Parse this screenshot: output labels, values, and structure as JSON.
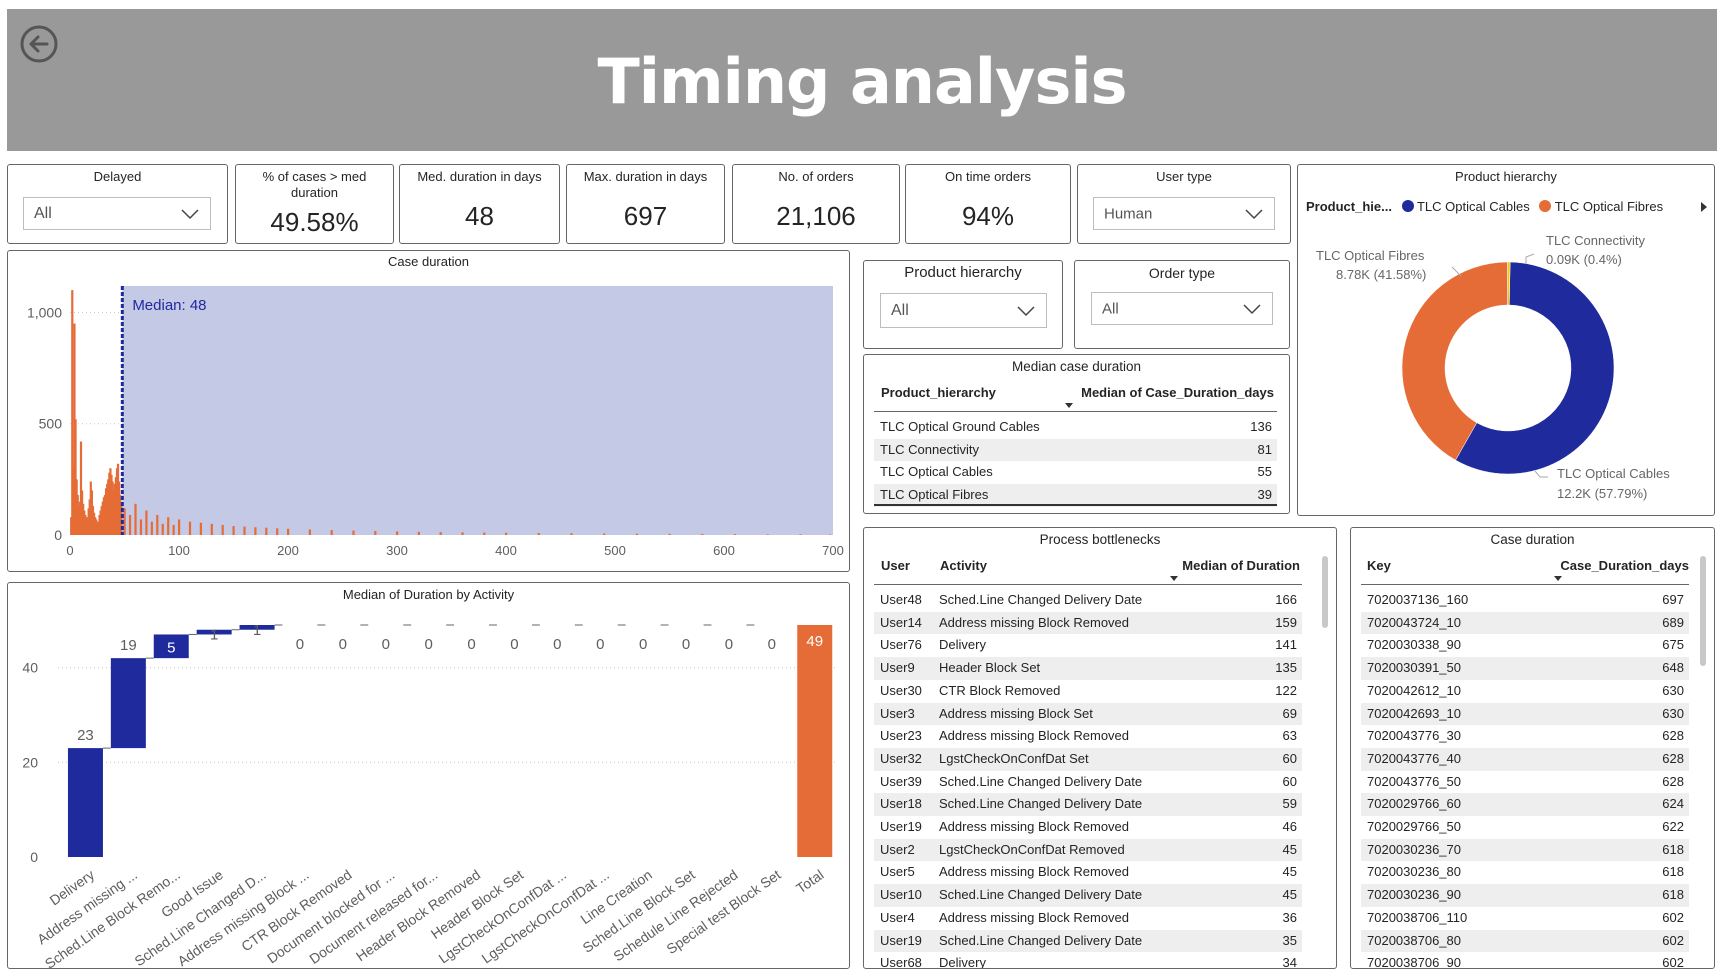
{
  "header": {
    "title": "Timing analysis",
    "back_icon": "arrow-left-circle-icon"
  },
  "kpis": {
    "delayed": {
      "label": "Delayed",
      "value": "All"
    },
    "pct_cases": {
      "label": "% of cases > med duration",
      "value": "49.58%"
    },
    "med_duration": {
      "label": "Med. duration in days",
      "value": "48"
    },
    "max_duration": {
      "label": "Max. duration in days",
      "value": "697"
    },
    "no_orders": {
      "label": "No. of orders",
      "value": "21,106"
    },
    "on_time": {
      "label": "On time orders",
      "value": "94%"
    },
    "user_type": {
      "label": "User type",
      "value": "Human"
    }
  },
  "filters": {
    "product_hierarchy": {
      "label": "Product hierarchy",
      "value": "All"
    },
    "order_type": {
      "label": "Order type",
      "value": "All"
    }
  },
  "donut": {
    "title": "Product hierarchy",
    "legend_title": "Product_hie...",
    "legend": [
      {
        "name": "TLC Optical Cables",
        "color": "#1F2A9C"
      },
      {
        "name": "TLC Optical Fibres",
        "color": "#E66C37"
      }
    ],
    "labels": {
      "fibres_name": "TLC Optical Fibres",
      "fibres_value": "8.78K (41.58%)",
      "connectivity_name": "TLC Connectivity",
      "connectivity_value": "0.09K (0.4%)",
      "cables_name": "TLC Optical Cables",
      "cables_value": "12.2K (57.79%)"
    }
  },
  "median_table": {
    "title": "Median case duration",
    "columns": [
      "Product_hierarchy",
      "Median of Case_Duration_days"
    ],
    "rows": [
      {
        "name": "TLC Optical Ground Cables",
        "value": "136"
      },
      {
        "name": "TLC Connectivity",
        "value": "81"
      },
      {
        "name": "TLC Optical Cables",
        "value": "55"
      },
      {
        "name": "TLC Optical Fibres",
        "value": "39"
      }
    ]
  },
  "bottlenecks": {
    "title": "Process bottlenecks",
    "columns": [
      "User",
      "Activity",
      "Median of Duration"
    ],
    "rows": [
      {
        "user": "User48",
        "activity": "Sched.Line Changed Delivery Date",
        "value": "166"
      },
      {
        "user": "User14",
        "activity": "Address missing Block Removed",
        "value": "159"
      },
      {
        "user": "User76",
        "activity": "Delivery",
        "value": "141"
      },
      {
        "user": "User9",
        "activity": "Header Block Set",
        "value": "135"
      },
      {
        "user": "User30",
        "activity": "CTR Block Removed",
        "value": "122"
      },
      {
        "user": "User3",
        "activity": "Address missing Block Set",
        "value": "69"
      },
      {
        "user": "User23",
        "activity": "Address missing Block Removed",
        "value": "63"
      },
      {
        "user": "User32",
        "activity": "LgstCheckOnConfDat Set",
        "value": "60"
      },
      {
        "user": "User39",
        "activity": "Sched.Line Changed Delivery Date",
        "value": "60"
      },
      {
        "user": "User18",
        "activity": "Sched.Line Changed Delivery Date",
        "value": "59"
      },
      {
        "user": "User19",
        "activity": "Address missing Block Removed",
        "value": "46"
      },
      {
        "user": "User2",
        "activity": "LgstCheckOnConfDat Removed",
        "value": "45"
      },
      {
        "user": "User5",
        "activity": "Address missing Block Removed",
        "value": "45"
      },
      {
        "user": "User10",
        "activity": "Sched.Line Changed Delivery Date",
        "value": "45"
      },
      {
        "user": "User4",
        "activity": "Address missing Block Removed",
        "value": "36"
      },
      {
        "user": "User19",
        "activity": "Sched.Line Changed Delivery Date",
        "value": "35"
      },
      {
        "user": "User68",
        "activity": "Delivery",
        "value": "34"
      }
    ]
  },
  "case_table": {
    "title": "Case duration",
    "columns": [
      "Key",
      "Case_Duration_days"
    ],
    "rows": [
      {
        "key": "7020037136_160",
        "value": "697"
      },
      {
        "key": "7020043724_10",
        "value": "689"
      },
      {
        "key": "7020030338_90",
        "value": "675"
      },
      {
        "key": "7020030391_50",
        "value": "648"
      },
      {
        "key": "7020042612_10",
        "value": "630"
      },
      {
        "key": "7020042693_10",
        "value": "630"
      },
      {
        "key": "7020043776_30",
        "value": "628"
      },
      {
        "key": "7020043776_40",
        "value": "628"
      },
      {
        "key": "7020043776_50",
        "value": "628"
      },
      {
        "key": "7020029766_60",
        "value": "624"
      },
      {
        "key": "7020029766_50",
        "value": "622"
      },
      {
        "key": "7020030236_70",
        "value": "618"
      },
      {
        "key": "7020030236_80",
        "value": "618"
      },
      {
        "key": "7020030236_90",
        "value": "618"
      },
      {
        "key": "7020038706_110",
        "value": "602"
      },
      {
        "key": "7020038706_80",
        "value": "602"
      },
      {
        "key": "7020038706_90",
        "value": "602"
      }
    ]
  },
  "chart_data": [
    {
      "type": "bar",
      "title": "Case duration",
      "annotation": "Median: 48",
      "median": 48,
      "xlim": [
        0,
        700
      ],
      "ylim": [
        0,
        1150
      ],
      "xticks": [
        0,
        100,
        200,
        300,
        400,
        500,
        600,
        700
      ],
      "yticks": [
        0,
        500,
        1000
      ],
      "ytick_labels": [
        "0",
        "500",
        "1,000"
      ],
      "colors": {
        "bars": "#E66C37",
        "shade": "#C4C9E6",
        "median_line": "#1F2A9C"
      },
      "series": [
        {
          "x": [
            1,
            2,
            3,
            4,
            5,
            6,
            7,
            8,
            9,
            10,
            11,
            12,
            13,
            14,
            15,
            16,
            17,
            18,
            19,
            20,
            21,
            22,
            23,
            24,
            25,
            26,
            27,
            28,
            29,
            30,
            31,
            32,
            33,
            34,
            35,
            36,
            37,
            38,
            39,
            40,
            41,
            42,
            43,
            44,
            45,
            46,
            47
          ],
          "values": [
            80,
            1100,
            300,
            950,
            520,
            250,
            180,
            130,
            150,
            420,
            200,
            140,
            110,
            90,
            80,
            70,
            120,
            160,
            240,
            200,
            130,
            100,
            80,
            70,
            60,
            50,
            90,
            110,
            130,
            150,
            170,
            180,
            210,
            230,
            250,
            280,
            300,
            270,
            240,
            200,
            230,
            260,
            300,
            320,
            240,
            180,
            140
          ]
        },
        {
          "x": [
            50,
            55,
            60,
            65,
            70,
            75,
            80,
            85,
            90,
            95,
            100,
            110,
            120,
            130,
            140,
            150,
            160,
            170,
            180,
            190,
            200,
            220,
            240,
            260,
            280,
            300,
            320,
            340,
            360,
            380,
            400,
            430,
            460,
            490,
            520,
            550,
            580,
            610,
            640,
            670,
            697
          ],
          "values": [
            120,
            90,
            140,
            70,
            110,
            60,
            90,
            50,
            80,
            45,
            70,
            60,
            55,
            50,
            45,
            40,
            38,
            35,
            33,
            30,
            28,
            25,
            22,
            20,
            18,
            16,
            14,
            13,
            12,
            11,
            10,
            9,
            8,
            7,
            6,
            5,
            5,
            4,
            3,
            3,
            2
          ]
        }
      ]
    },
    {
      "type": "bar",
      "subtype": "waterfall",
      "title": "Median of Duration by Activity",
      "categories": [
        "Delivery",
        "Address missing ...",
        "Sched.Line Block Remo...",
        "Good Issue",
        "Sched.Line Changed D...",
        "Address missing Block ...",
        "CTR Block Removed",
        "Document blocked for ...",
        "Document released for...",
        "Header Block Removed",
        "Header Block Set",
        "LgstCheckOnConfDat ...",
        "LgstCheckOnConfDat ...",
        "Line Creation",
        "Sched.Line Block Set",
        "Schedule Line Rejected",
        "Special test Block Set",
        "Total"
      ],
      "values": [
        23,
        19,
        5,
        1,
        1,
        0,
        0,
        0,
        0,
        0,
        0,
        0,
        0,
        0,
        0,
        0,
        0,
        49
      ],
      "data_labels": [
        "23",
        "19",
        "5",
        "1",
        "1",
        "0",
        "0",
        "0",
        "0",
        "0",
        "0",
        "0",
        "0",
        "0",
        "0",
        "0",
        "0",
        "49"
      ],
      "ylim": [
        0,
        49
      ],
      "yticks": [
        0,
        20,
        40
      ],
      "colors": {
        "increase": "#1F2A9C",
        "total": "#E66C37"
      }
    },
    {
      "type": "pie",
      "subtype": "donut",
      "title": "Product hierarchy",
      "categories": [
        "TLC Optical Cables",
        "TLC Optical Fibres",
        "TLC Connectivity"
      ],
      "values": [
        57.79,
        41.58,
        0.4
      ],
      "colors": [
        "#1F2A9C",
        "#E66C37",
        "#F2C80F"
      ]
    }
  ]
}
